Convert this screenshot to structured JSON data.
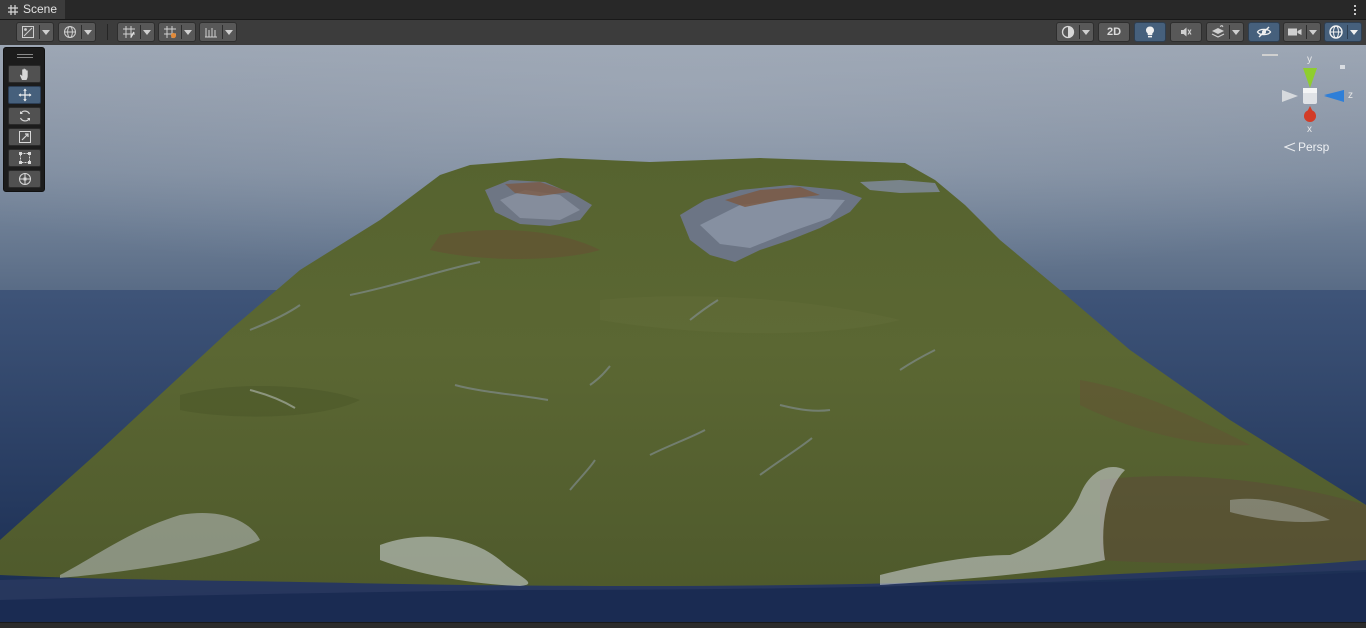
{
  "window": {
    "tab_title": "Scene",
    "tab_icon": "grid-hash-icon",
    "menu_icon": "kebab-menu-icon"
  },
  "toolbar": {
    "left_buttons": [
      {
        "name": "draw-mode-dropdown",
        "icon": "shaded-draw-mode-icon"
      },
      {
        "name": "global-local-dropdown",
        "icon": "globe-icon"
      },
      {
        "name": "grid-snapping-dropdown",
        "icon": "grid-snap-icon"
      },
      {
        "name": "grid-visibility-dropdown",
        "icon": "grid-visibility-icon"
      },
      {
        "name": "increment-snap-dropdown",
        "icon": "ruler-snap-icon"
      }
    ],
    "right_buttons": [
      {
        "name": "render-mode-dropdown",
        "icon": "sphere-shading-icon"
      },
      {
        "name": "2d-toggle-button",
        "label": "2D"
      },
      {
        "name": "lighting-toggle-button",
        "icon": "lightbulb-icon",
        "active": true
      },
      {
        "name": "audio-toggle-button",
        "icon": "mute-speaker-icon"
      },
      {
        "name": "effects-dropdown",
        "icon": "layers-effects-icon"
      },
      {
        "name": "hidden-objects-toggle-button",
        "icon": "eye-slash-icon",
        "active": true
      },
      {
        "name": "camera-dropdown",
        "icon": "camera-icon"
      },
      {
        "name": "gizmos-dropdown",
        "icon": "gizmo-globe-icon",
        "active": true
      }
    ],
    "label_2d": "2D"
  },
  "tools": [
    {
      "name": "hand-tool",
      "icon": "hand-icon",
      "active": false
    },
    {
      "name": "move-tool",
      "icon": "move-arrows-icon",
      "active": true
    },
    {
      "name": "rotate-tool",
      "icon": "rotate-icon",
      "active": false
    },
    {
      "name": "scale-tool",
      "icon": "scale-icon",
      "active": false
    },
    {
      "name": "rect-tool",
      "icon": "rect-transform-icon",
      "active": false
    },
    {
      "name": "transform-tool",
      "icon": "transform-icon",
      "active": false
    }
  ],
  "gizmo": {
    "y_label": "y",
    "z_label": "z",
    "x_label": "x",
    "projection_label": "Persp",
    "y_color": "#8fce2e",
    "z_color": "#2f7fd8",
    "x_color": "#d23b26"
  },
  "colors": {
    "active_button": "#46607c",
    "toolbar_bg": "#3c3c3c",
    "terrain_grass": "#56622e",
    "water": "#1e2f56"
  }
}
